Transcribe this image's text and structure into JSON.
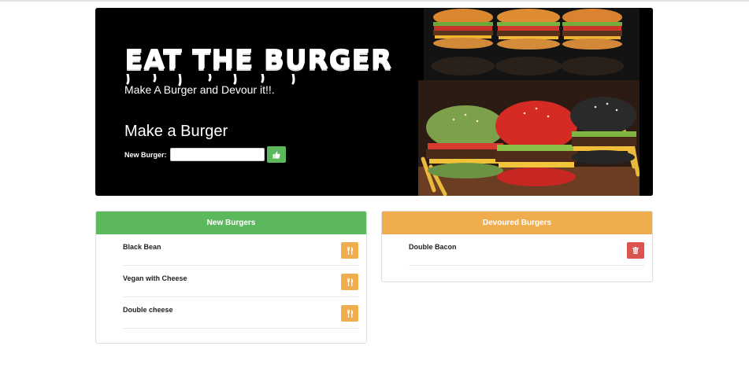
{
  "hero": {
    "title": "EAT THE BURGER",
    "subtitle": "Make A Burger and Devour it!!.",
    "form_heading": "Make a Burger",
    "input_label": "New Burger:",
    "input_value": ""
  },
  "new_burgers": {
    "heading": "New Burgers",
    "items": [
      {
        "name": "Black Bean"
      },
      {
        "name": "Vegan with Cheese"
      },
      {
        "name": "Double cheese"
      }
    ]
  },
  "devoured_burgers": {
    "heading": "Devoured Burgers",
    "items": [
      {
        "name": "Double Bacon"
      }
    ]
  },
  "colors": {
    "green": "#5cb85c",
    "orange": "#f0ad4e",
    "red": "#d9534f"
  },
  "icons": {
    "submit": "thumbs-up-icon",
    "devour": "fork-knife-icon",
    "delete": "trash-icon"
  }
}
